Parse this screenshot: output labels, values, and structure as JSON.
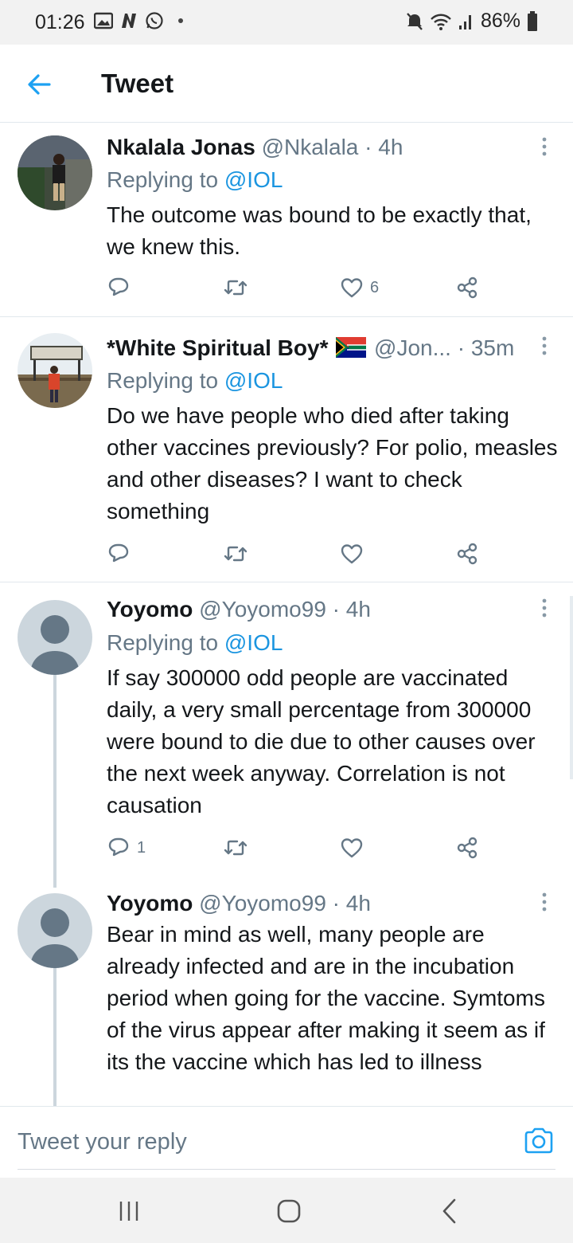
{
  "status_bar": {
    "time": "01:26",
    "battery": "86%",
    "icons": [
      "gallery-icon",
      "n-icon",
      "whatsapp-icon",
      "dot-icon",
      "mute-icon",
      "wifi-icon",
      "signal-icon",
      "battery-icon"
    ]
  },
  "header": {
    "title": "Tweet",
    "back_icon": "arrow-left-icon"
  },
  "tweets": [
    {
      "name": "Nkalala Jonas",
      "handle": "@Nkalala",
      "time": "· 4h",
      "replying_prefix": "Replying to ",
      "replying_to": "@IOL",
      "text": "The outcome was bound to be exactly that, we knew this.",
      "reply_count": "",
      "retweet_count": "",
      "like_count": "6"
    },
    {
      "name": "*White Spiritual Boy*",
      "flag": "south-africa-flag",
      "handle": "@Jon...",
      "time": "· 35m",
      "replying_prefix": "Replying to ",
      "replying_to": "@IOL",
      "avatar_sign_text": "NELSON MANDELA CAPTURE SITE",
      "text": "Do we have people who died after taking other vaccines previously? For polio, measles and other diseases? I want to check something",
      "reply_count": "",
      "retweet_count": "",
      "like_count": ""
    },
    {
      "name": "Yoyomo",
      "handle": "@Yoyomo99",
      "time": "· 4h",
      "replying_prefix": "Replying to ",
      "replying_to": "@IOL",
      "text": "If say 300000 odd people are vaccinated daily, a very small percentage from 300000 were bound to die due to other causes over the next week anyway. Correlation is not causation",
      "reply_count": "1",
      "retweet_count": "",
      "like_count": ""
    },
    {
      "name": "Yoyomo",
      "handle": "@Yoyomo99",
      "time": "· 4h",
      "text": "Bear in mind as well, many people are already infected and are in the incubation period when going for the vaccine. Symtoms of the virus appear after making it seem as if its the vaccine which has led to illness"
    }
  ],
  "reply_bar": {
    "placeholder": "Tweet your reply",
    "camera_icon": "camera-icon"
  },
  "nav_bar": {
    "icons": [
      "recents-icon",
      "home-icon",
      "back-icon"
    ]
  },
  "colors": {
    "accent": "#1da1f2",
    "secondary_text": "#657786",
    "divider": "#e1e8ed",
    "avatar_placeholder": "#ccd6dd"
  }
}
